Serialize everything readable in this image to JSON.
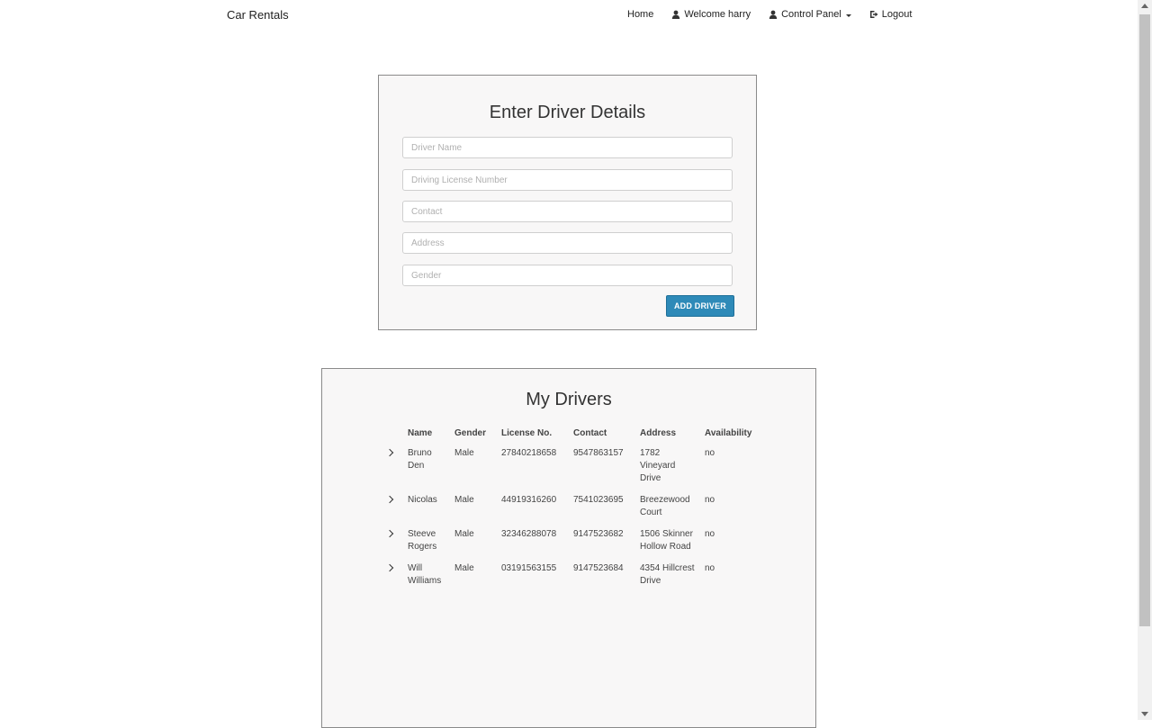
{
  "navbar": {
    "brand": "Car Rentals",
    "home": "Home",
    "welcome": "Welcome harry",
    "control_panel": "Control Panel",
    "logout": "Logout"
  },
  "form": {
    "title": "Enter Driver Details",
    "fields": {
      "name": {
        "placeholder": "Driver Name",
        "value": ""
      },
      "license": {
        "placeholder": "Driving License Number",
        "value": ""
      },
      "contact": {
        "placeholder": "Contact",
        "value": ""
      },
      "address": {
        "placeholder": "Address",
        "value": ""
      },
      "gender": {
        "placeholder": "Gender",
        "value": ""
      }
    },
    "submit_label": "ADD DRIVER",
    "button_color": "#2e8ab8"
  },
  "drivers": {
    "title": "My Drivers",
    "columns": [
      "Name",
      "Gender",
      "License No.",
      "Contact",
      "Address",
      "Availability"
    ],
    "rows": [
      {
        "name": "Bruno Den",
        "gender": "Male",
        "license": "27840218658",
        "contact": "9547863157",
        "address": "1782 Vineyard Drive",
        "availability": "no"
      },
      {
        "name": "Nicolas",
        "gender": "Male",
        "license": "44919316260",
        "contact": "7541023695",
        "address": "Breezewood Court",
        "availability": "no"
      },
      {
        "name": "Steeve Rogers",
        "gender": "Male",
        "license": "32346288078",
        "contact": "9147523682",
        "address": "1506 Skinner Hollow Road",
        "availability": "no"
      },
      {
        "name": "Will Williams",
        "gender": "Male",
        "license": "03191563155",
        "contact": "9147523684",
        "address": "4354 Hillcrest Drive",
        "availability": "no"
      }
    ]
  }
}
